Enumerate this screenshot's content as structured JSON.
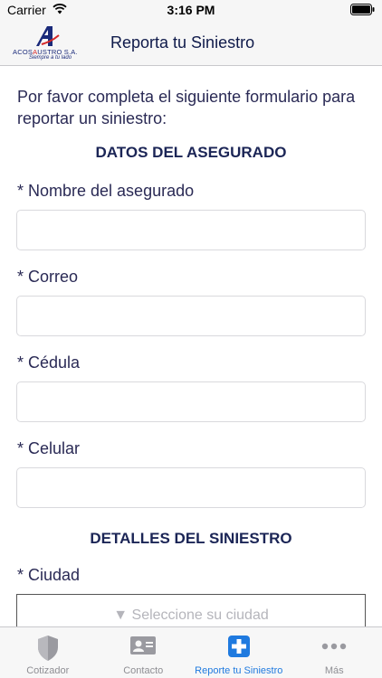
{
  "status_bar": {
    "carrier": "Carrier",
    "time": "3:16 PM"
  },
  "nav": {
    "logo_prefix": "ACOS",
    "logo_accent": "A",
    "logo_suffix": "USTRO S.A.",
    "logo_tagline": "Siempre a tu lado",
    "title": "Reporta tu Siniestro"
  },
  "form": {
    "intro": "Por favor completa el siguiente formulario para reportar un siniestro:",
    "section_insured": "DATOS DEL ASEGURADO",
    "fields": [
      {
        "label": "* Nombre del asegurado",
        "value": ""
      },
      {
        "label": "* Correo",
        "value": ""
      },
      {
        "label": "* Cédula",
        "value": ""
      },
      {
        "label": "* Celular",
        "value": ""
      }
    ],
    "section_claim": "DETALLES DEL SINIESTRO",
    "city_label": "* Ciudad",
    "city_placeholder": "▼ Seleccione su ciudad"
  },
  "tabs": [
    {
      "label": "Cotizador",
      "icon": "shield-icon"
    },
    {
      "label": "Contacto",
      "icon": "contact-card-icon"
    },
    {
      "label": "Reporte tu Siniestro",
      "icon": "plus-cross-icon",
      "active": true
    },
    {
      "label": "Más",
      "icon": "more-dots-icon"
    }
  ],
  "colors": {
    "accent": "#1f7adf",
    "title": "#1b2556",
    "logo_blue": "#1a2a7a",
    "logo_red": "#d62828"
  }
}
